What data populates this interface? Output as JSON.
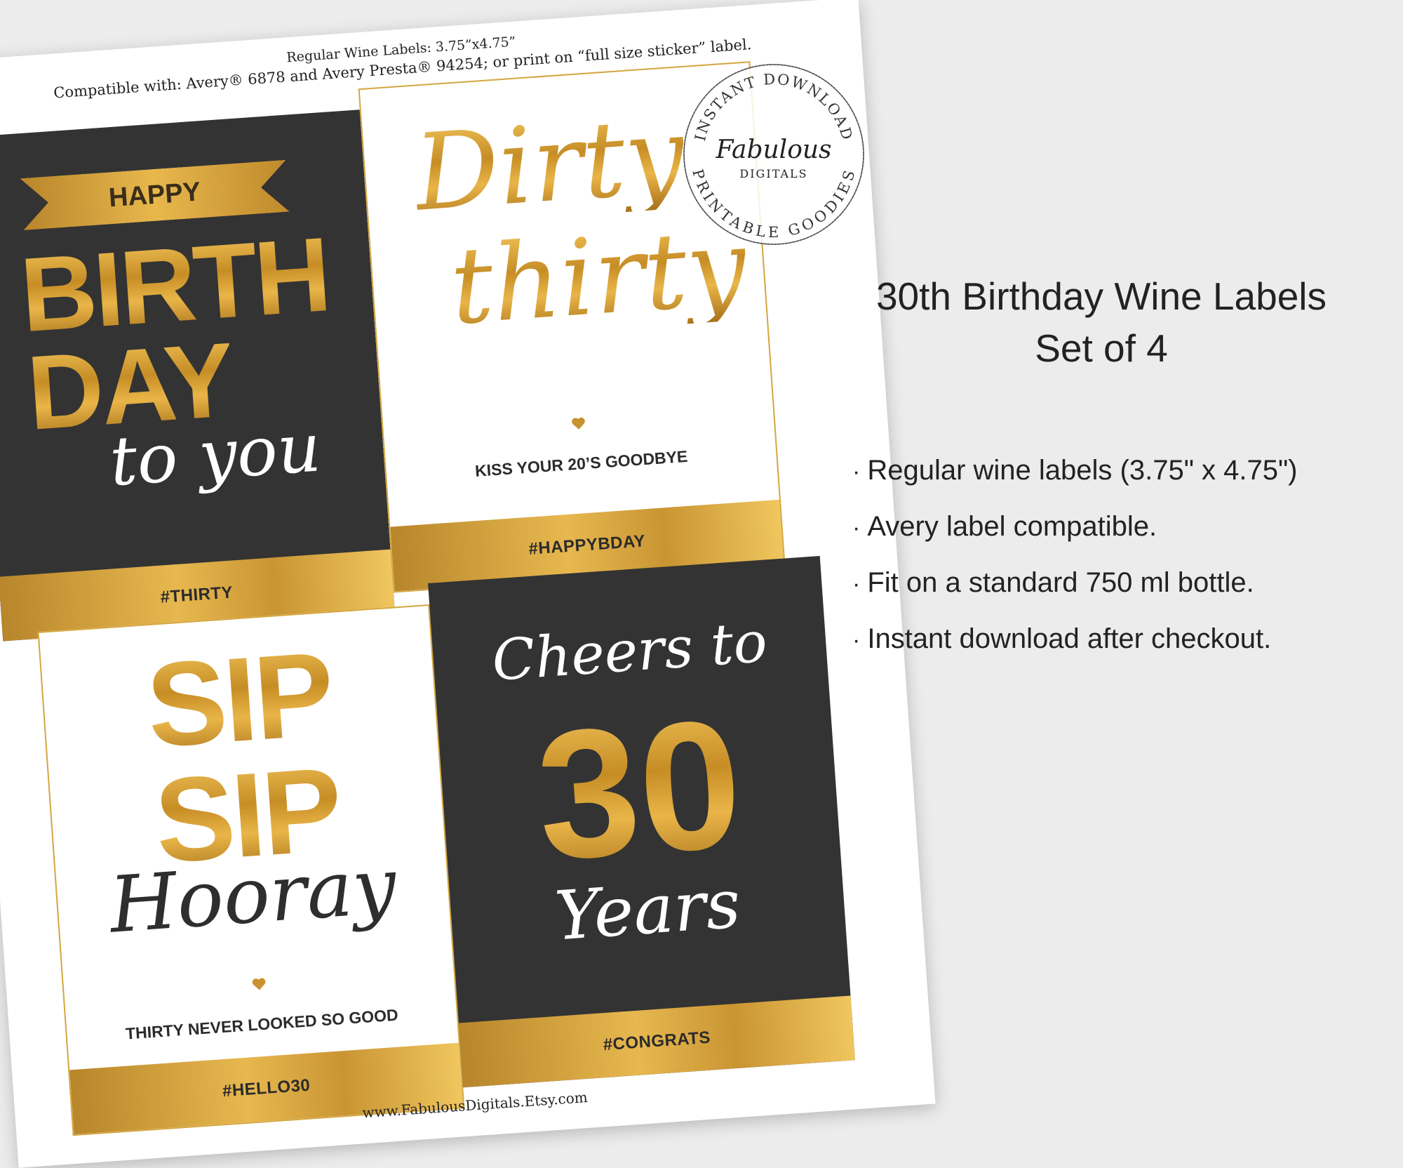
{
  "sheet": {
    "header_line1": "Regular Wine Labels: 3.75”x4.75”",
    "header_line2": "Compatible with: Avery® 6878 and Avery Presta® 94254; or print on “full size sticker” label.",
    "footer": "www.FabulousDigitals.Etsy.com"
  },
  "labels": [
    {
      "ribbon": "HAPPY",
      "line1": "BIRTH",
      "line2": "DAY",
      "script": "to you",
      "band": "#THIRTY"
    },
    {
      "script1": "Dirty",
      "script2": "thirty",
      "tagline": "KISS YOUR 20’S GOODBYE",
      "band": "#HAPPYBDAY"
    },
    {
      "line1": "SIP",
      "line2": "SIP",
      "script": "Hooray",
      "tagline": "THIRTY NEVER LOOKED SO GOOD",
      "band": "#HELLO30"
    },
    {
      "script1": "Cheers to",
      "number": "30",
      "script2": "Years",
      "band": "#CONGRATS"
    }
  ],
  "stamp": {
    "top_text": "INSTANT DOWNLOAD",
    "brand": "Fabulous",
    "sub": "DIGITALS",
    "bottom_text": "PRINTABLE GOODIES"
  },
  "product": {
    "title": "30th Birthday Wine Labels",
    "subtitle": "Set of 4",
    "bullet_symbol": "·",
    "features": [
      "Regular wine labels (3.75\" x 4.75\")",
      "Avery label compatible.",
      "Fit on a standard 750 ml bottle.",
      "Instant download after checkout."
    ]
  },
  "colors": {
    "gold": "#d4a640",
    "dark": "#333333",
    "background": "#ececec"
  }
}
